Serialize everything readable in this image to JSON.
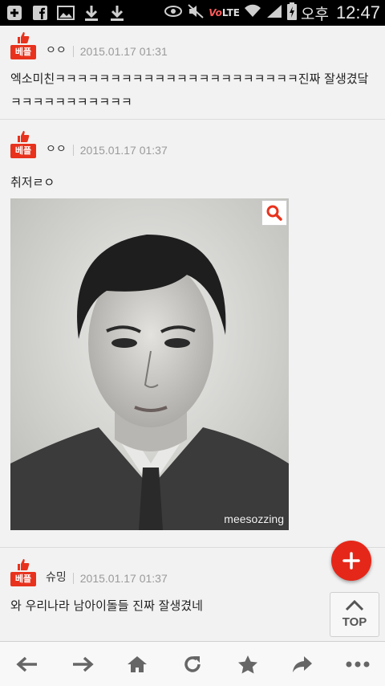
{
  "statusbar": {
    "volte": "Vo",
    "lte": "LTE",
    "ampm": "오후",
    "time": "12:47"
  },
  "comments": [
    {
      "badge": "베플",
      "author": "ㅇㅇ",
      "date": "2015.01.17 01:31",
      "text": "엑소미친ㅋㅋㅋㅋㅋㅋㅋㅋㅋㅋㅋㅋㅋㅋㅋㅋㅋㅋㅋㅋㅋㅋ진짜 잘생겼닼ㅋㅋㅋㅋㅋㅋㅋㅋㅋㅋㅋ"
    },
    {
      "badge": "베플",
      "author": "ㅇㅇ",
      "date": "2015.01.17 01:37",
      "text": "취저ㄹㅇ",
      "image_watermark": "meesozzing"
    },
    {
      "badge": "베플",
      "author": "슈밍",
      "date": "2015.01.17 01:37",
      "text": "와 우리나라 남아이돌들 진짜 잘생겼네"
    }
  ],
  "top_button": {
    "label": "TOP"
  },
  "colors": {
    "accent": "#e8321d",
    "fab": "#e52719"
  },
  "icons": {
    "statusbar_left": [
      "add-box-icon",
      "facebook-icon",
      "image-icon",
      "download-icon",
      "download-icon"
    ],
    "statusbar_right": [
      "eye-icon",
      "mute-icon",
      "wifi-icon",
      "signal-icon",
      "battery-icon"
    ],
    "bottom_nav": [
      "back-icon",
      "forward-icon",
      "home-icon",
      "refresh-icon",
      "star-icon",
      "share-icon",
      "more-icon"
    ]
  }
}
